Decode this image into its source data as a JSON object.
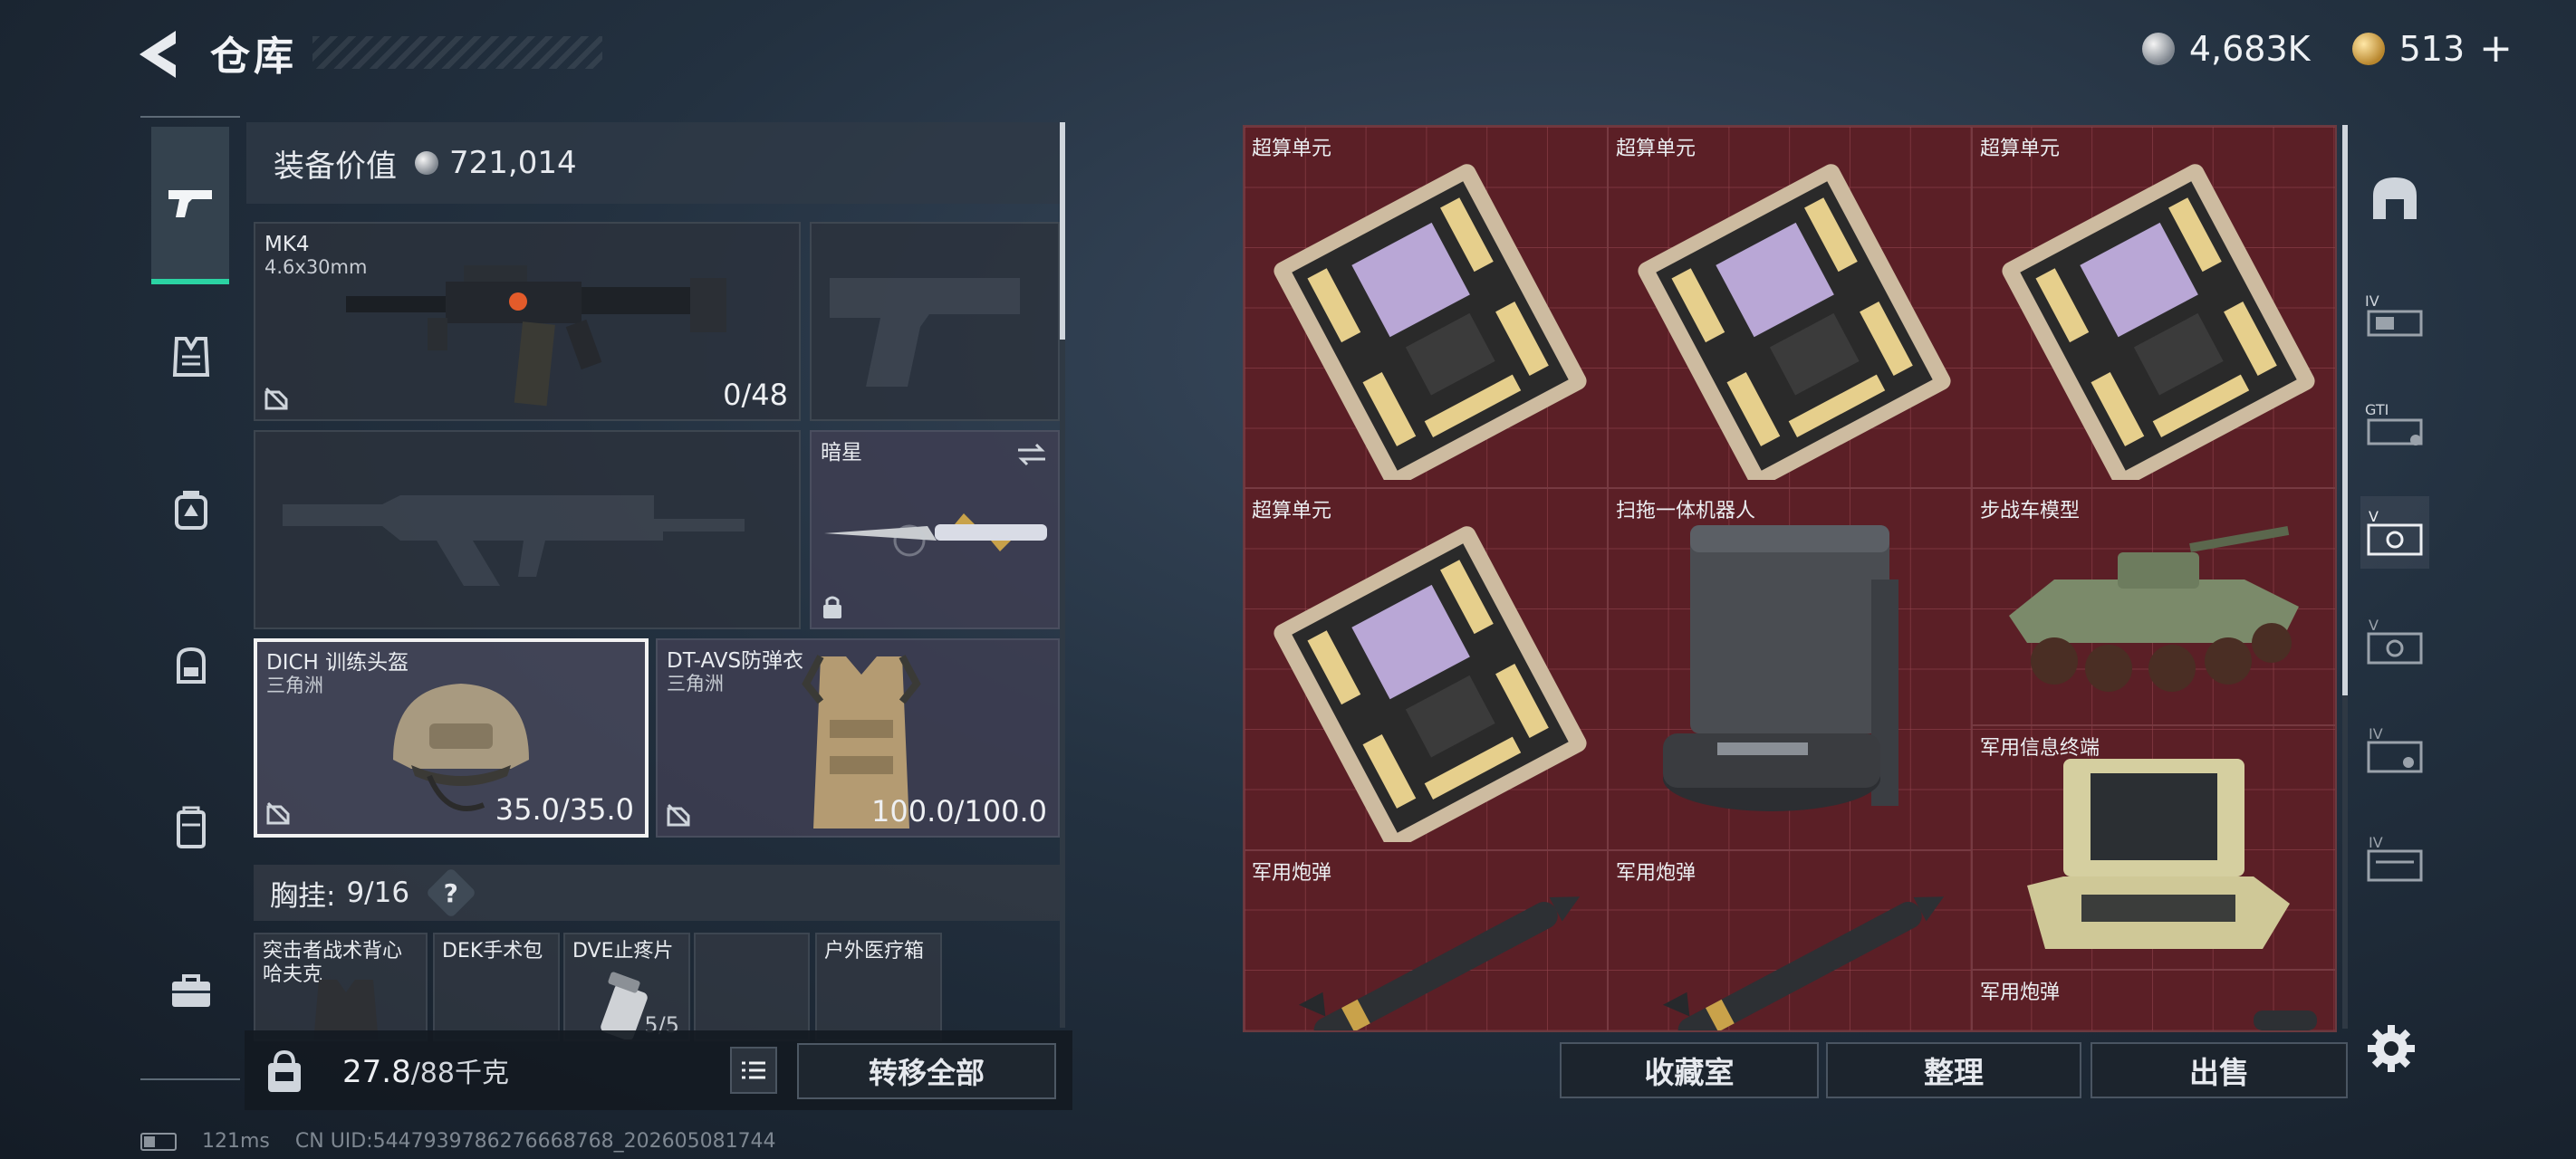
{
  "header": {
    "title": "仓库",
    "currency_primary": "4,683K",
    "currency_secondary": "513",
    "currency_secondary_plus": "+"
  },
  "loadout": {
    "equipment_value_label": "装备价值",
    "equipment_value": "721,014",
    "primary_weapon": {
      "name": "MK4",
      "ammo_type": "4.6x30mm",
      "ammo": "0/48"
    },
    "melee": {
      "name": "暗星"
    },
    "helmet": {
      "name": "DICH 训练头盔",
      "map": "三角洲",
      "durability": "35.0/35.0"
    },
    "armor": {
      "name": "DT-AVS防弹衣",
      "map": "三角洲",
      "durability": "100.0/100.0"
    },
    "chest_rig": {
      "label": "胸挂:",
      "capacity": "9/16",
      "help": "?"
    },
    "rig_items": [
      {
        "name": "突击者战术背心",
        "sub": "哈夫克"
      },
      {
        "name": "DEK手术包"
      },
      {
        "name": "DVE止疼片",
        "count": "5/5"
      },
      {
        "name": ""
      },
      {
        "name": "户外医疗箱"
      }
    ],
    "weight": "27.8",
    "weight_max": "/88千克",
    "transfer_all": "转移全部"
  },
  "storage": {
    "items": [
      {
        "name": "超算单元"
      },
      {
        "name": "超算单元"
      },
      {
        "name": "超算单元"
      },
      {
        "name": "超算单元"
      },
      {
        "name": "扫拖一体机器人"
      },
      {
        "name": "步战车模型"
      },
      {
        "name": "军用信息终端"
      },
      {
        "name": "军用炮弹"
      },
      {
        "name": "军用炮弹"
      },
      {
        "name": "军用炮弹"
      }
    ]
  },
  "category_nav": [
    {
      "icon": "arch-icon",
      "tier": ""
    },
    {
      "icon": "rig-icon",
      "tier": "IV"
    },
    {
      "icon": "gti-icon",
      "tier": "GTI"
    },
    {
      "icon": "case-icon",
      "tier": "V"
    },
    {
      "icon": "case-icon",
      "tier": "V"
    },
    {
      "icon": "case-icon",
      "tier": "IV"
    },
    {
      "icon": "case-icon",
      "tier": "IV"
    }
  ],
  "actions": {
    "collection": "收藏室",
    "sort": "整理",
    "sell": "出售"
  },
  "footer": {
    "ping": "121ms",
    "uid": "CN UID:5447939786276668768_202605081744"
  },
  "colors": {
    "accent": "#2bd3a3",
    "storage_bg": "#5b1f26",
    "panel": "#2c323c"
  }
}
